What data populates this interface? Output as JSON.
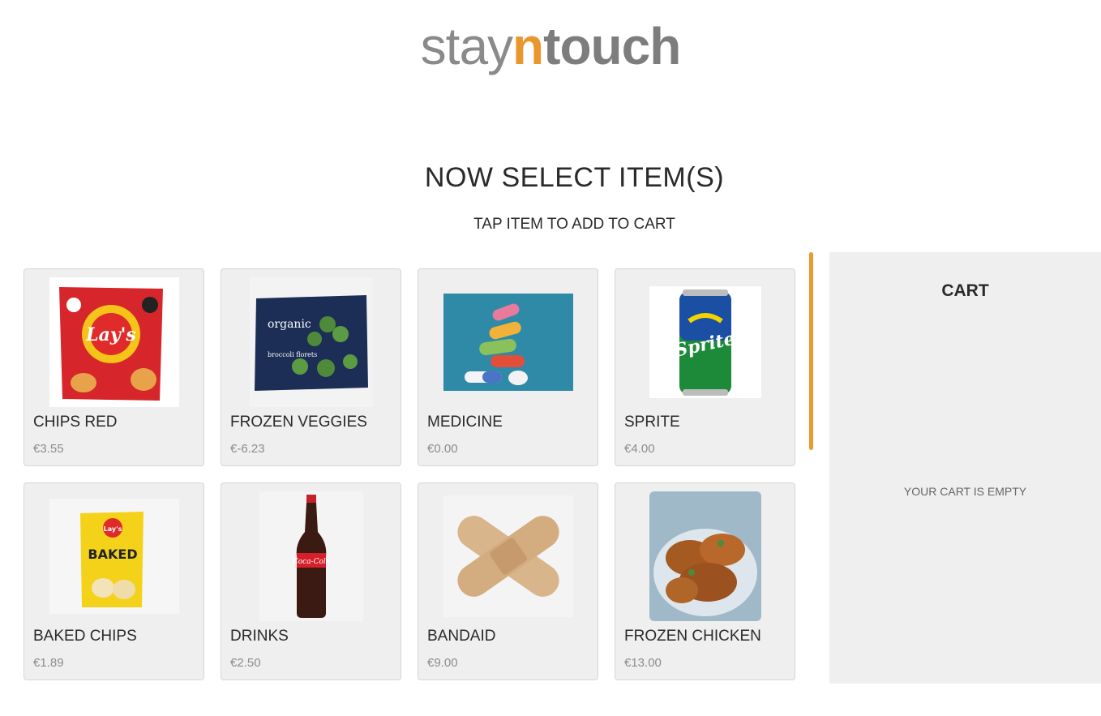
{
  "brand": {
    "part1": "stay",
    "part2": "n",
    "part3": "touch",
    "accent_color": "#e9962c"
  },
  "heading": {
    "title": "NOW SELECT ITEM(S)",
    "subtitle": "TAP ITEM TO ADD TO CART"
  },
  "items": [
    {
      "name": "CHIPS RED",
      "price": "€3.55",
      "icon": "chips-bag-red"
    },
    {
      "name": "FROZEN VEGGIES",
      "price": "€-6.23",
      "icon": "frozen-broccoli-bag"
    },
    {
      "name": "MEDICINE",
      "price": "€0.00",
      "icon": "pills"
    },
    {
      "name": "SPRITE",
      "price": "€4.00",
      "icon": "soda-can"
    },
    {
      "name": "BAKED CHIPS",
      "price": "€1.89",
      "icon": "chips-bag-yellow"
    },
    {
      "name": "DRINKS",
      "price": "€2.50",
      "icon": "cola-bottle"
    },
    {
      "name": "BANDAID",
      "price": "€9.00",
      "icon": "bandage"
    },
    {
      "name": "FROZEN CHICKEN",
      "price": "€13.00",
      "icon": "fried-chicken"
    }
  ],
  "cart": {
    "title": "CART",
    "empty_text": "YOUR CART IS EMPTY"
  }
}
